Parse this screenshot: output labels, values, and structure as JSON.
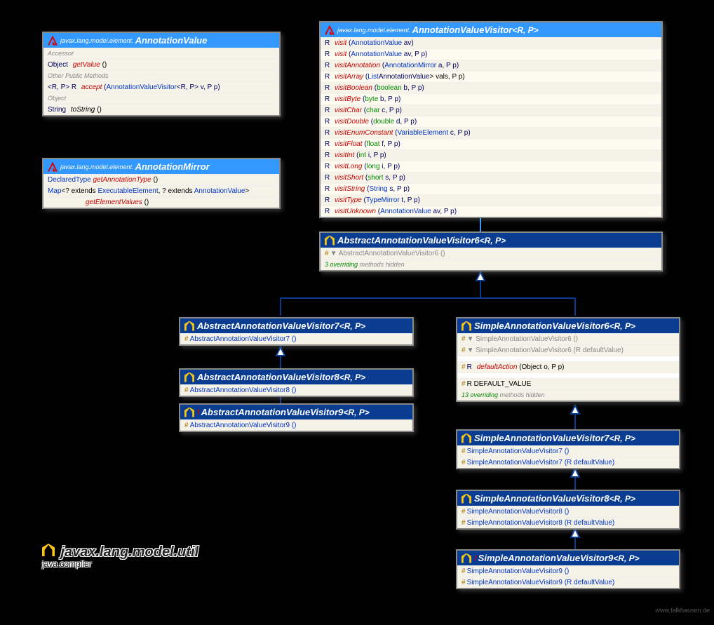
{
  "attribution": "www.falkhausen.de",
  "packageTitle": {
    "name": "javax.lang.model.util",
    "sub": "java.compiler"
  },
  "boxes": {
    "annotationValue": {
      "pkg": "javax.lang.model.element.",
      "cls": "AnnotationValue",
      "sections": {
        "accessor": "Accessor",
        "other": "Other Public Methods",
        "object": "Object"
      },
      "rows": {
        "getValue": {
          "ret": "Object",
          "name": "getValue",
          "params": "()"
        },
        "accept": {
          "ret": "<R, P> R",
          "name": "accept",
          "params": "(AnnotationValueVisitor<R, P> v, P p)"
        },
        "toString": {
          "ret": "String",
          "name": "toString",
          "params": "()"
        }
      }
    },
    "annotationMirror": {
      "pkg": "javax.lang.model.element.",
      "cls": "AnnotationMirror",
      "rows": {
        "getAnnotationType": {
          "ret": "DeclaredType",
          "name": "getAnnotationType",
          "params": "()"
        },
        "getElementValues": {
          "ret": "Map<? extends ExecutableElement, ? extends AnnotationValue>",
          "name": "getElementValues",
          "params": "()"
        }
      }
    },
    "visitor": {
      "pkg": "javax.lang.model.element.",
      "cls": "AnnotationValueVisitor",
      "generic": "<R, P>",
      "rows": [
        {
          "ret": "R",
          "name": "visit",
          "params": "(AnnotationValue av)"
        },
        {
          "ret": "R",
          "name": "visit",
          "params": "(AnnotationValue av, P p)"
        },
        {
          "ret": "R",
          "name": "visitAnnotation",
          "params": "(AnnotationMirror a, P p)"
        },
        {
          "ret": "R",
          "name": "visitArray",
          "params": "(List<? extends AnnotationValue> vals, P p)"
        },
        {
          "ret": "R",
          "name": "visitBoolean",
          "params": "(boolean b, P p)"
        },
        {
          "ret": "R",
          "name": "visitByte",
          "params": "(byte b, P p)"
        },
        {
          "ret": "R",
          "name": "visitChar",
          "params": "(char c, P p)"
        },
        {
          "ret": "R",
          "name": "visitDouble",
          "params": "(double d, P p)"
        },
        {
          "ret": "R",
          "name": "visitEnumConstant",
          "params": "(VariableElement c, P p)"
        },
        {
          "ret": "R",
          "name": "visitFloat",
          "params": "(float f, P p)"
        },
        {
          "ret": "R",
          "name": "visitInt",
          "params": "(int i, P p)"
        },
        {
          "ret": "R",
          "name": "visitLong",
          "params": "(long i, P p)"
        },
        {
          "ret": "R",
          "name": "visitShort",
          "params": "(short s, P p)"
        },
        {
          "ret": "R",
          "name": "visitString",
          "params": "(String s, P p)"
        },
        {
          "ret": "R",
          "name": "visitType",
          "params": "(TypeMirror t, P p)"
        },
        {
          "ret": "R",
          "name": "visitUnknown",
          "params": "(AnnotationValue av, P p)"
        }
      ]
    },
    "aavv6": {
      "cls": "AbstractAnnotationValueVisitor6",
      "generic": "<R, P>",
      "ctor": "AbstractAnnotationValueVisitor6 ()",
      "note": "3 overriding methods hidden"
    },
    "aavv7": {
      "cls": "AbstractAnnotationValueVisitor7",
      "generic": "<R, P>",
      "ctor": "AbstractAnnotationValueVisitor7 ()"
    },
    "aavv8": {
      "cls": "AbstractAnnotationValueVisitor8",
      "generic": "<R, P>",
      "ctor": "AbstractAnnotationValueVisitor8 ()"
    },
    "aavv9": {
      "cls": "AbstractAnnotationValueVisitor9",
      "generic": "<R, P>",
      "ctor": "AbstractAnnotationValueVisitor9 ()",
      "new": true
    },
    "savv6": {
      "cls": "SimpleAnnotationValueVisitor6",
      "generic": "<R, P>",
      "ctors": [
        "SimpleAnnotationValueVisitor6 ()",
        "SimpleAnnotationValueVisitor6 (R defaultValue)"
      ],
      "defaultAction": {
        "ret": "R",
        "name": "defaultAction",
        "params": "(Object o, P p)"
      },
      "field": "R DEFAULT_VALUE",
      "note": "13 overriding methods hidden"
    },
    "savv7": {
      "cls": "SimpleAnnotationValueVisitor7",
      "generic": "<R, P>",
      "ctors": [
        "SimpleAnnotationValueVisitor7 ()",
        "SimpleAnnotationValueVisitor7 (R defaultValue)"
      ]
    },
    "savv8": {
      "cls": "SimpleAnnotationValueVisitor8",
      "generic": "<R, P>",
      "ctors": [
        "SimpleAnnotationValueVisitor8 ()",
        "SimpleAnnotationValueVisitor8 (R defaultValue)"
      ]
    },
    "savv9": {
      "cls": "SimpleAnnotationValueVisitor9",
      "generic": "<R, P>",
      "ctors": [
        "SimpleAnnotationValueVisitor9 ()",
        "SimpleAnnotationValueVisitor9 (R defaultValue)"
      ],
      "new": true
    }
  }
}
